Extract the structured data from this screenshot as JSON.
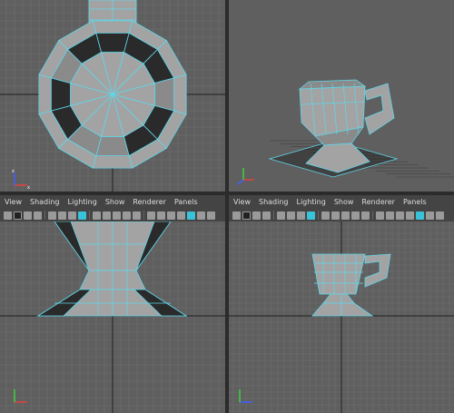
{
  "colors": {
    "viewport_bg": "#5f5f5f",
    "grid": "#707070",
    "grid_axis": "#202020",
    "wire": "#5fd7ea",
    "shade_light": "#a3a3a3",
    "shade_mid": "#8a8a8a",
    "shade_dark": "#2a2a2a",
    "axis_x": "#e04040",
    "axis_y": "#40d040",
    "axis_z": "#4060ff",
    "accent": "#38c3d8"
  },
  "viewports": [
    {
      "name": "top-view",
      "menu": []
    },
    {
      "name": "perspective-view",
      "menu": []
    },
    {
      "name": "front-view",
      "menu": [
        "View",
        "Shading",
        "Lighting",
        "Show",
        "Renderer",
        "Panels"
      ]
    },
    {
      "name": "side-view",
      "menu": [
        "View",
        "Shading",
        "Lighting",
        "Show",
        "Renderer",
        "Panels"
      ]
    }
  ],
  "menus": {
    "left": {
      "view": "View",
      "shading": "Shading",
      "lighting": "Lighting",
      "show": "Show",
      "renderer": "Renderer",
      "panels": "Panels"
    },
    "right": {
      "view": "View",
      "shading": "Shading",
      "lighting": "Lighting",
      "show": "Show",
      "renderer": "Renderer",
      "panels": "Panels"
    }
  },
  "toolbar_icons": [
    "camera-icon",
    "lock-icon",
    "bookmark-icon",
    "film-icon",
    "grid-icon",
    "wireframe-icon",
    "smooth-shade-icon",
    "textured-icon",
    "light-icon",
    "shadow-icon",
    "xray-icon",
    "isolate-icon",
    "frame-all-icon",
    "resolution-gate-icon"
  ]
}
